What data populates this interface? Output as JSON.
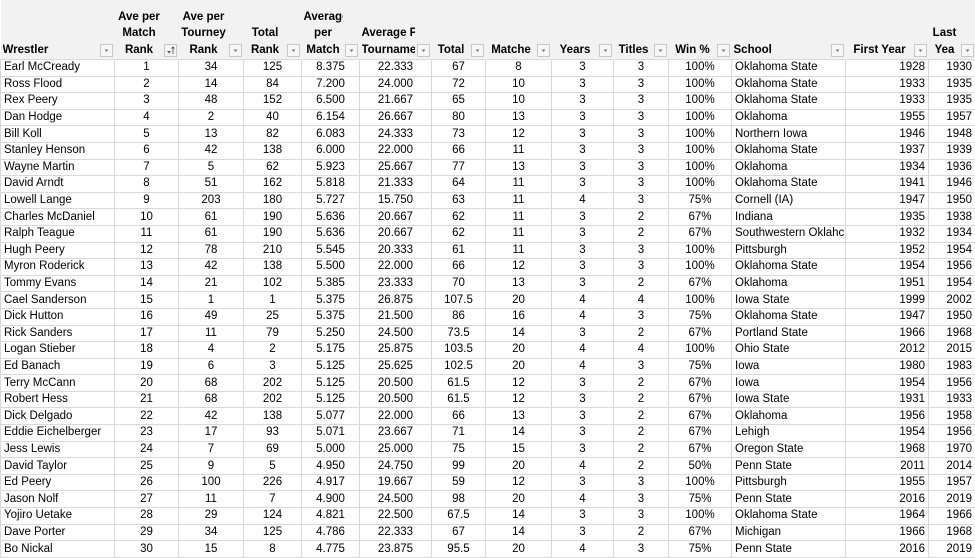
{
  "columns": [
    {
      "key": "wrestler",
      "label_lines": [
        "Wrestler"
      ],
      "align": "left",
      "filter": "dropdown"
    },
    {
      "key": "match_rank",
      "label_lines": [
        "Ave per",
        "Match",
        "Rank"
      ],
      "align": "center",
      "filter": "sorted-ascending"
    },
    {
      "key": "tourney_rank",
      "label_lines": [
        "Ave per",
        "Tourney",
        "Rank"
      ],
      "align": "center",
      "filter": "dropdown"
    },
    {
      "key": "total_rank",
      "label_lines": [
        "Total",
        "Rank"
      ],
      "align": "center",
      "filter": "dropdown"
    },
    {
      "key": "avg_match",
      "label_lines": [
        "Average",
        "per",
        "Match"
      ],
      "align": "center",
      "filter": "dropdown"
    },
    {
      "key": "avg_tourney",
      "label_lines": [
        "Average Per",
        "Tourname"
      ],
      "align": "center",
      "filter": "dropdown"
    },
    {
      "key": "total",
      "label_lines": [
        "Total"
      ],
      "align": "center",
      "filter": "dropdown"
    },
    {
      "key": "matches",
      "label_lines": [
        "Matche"
      ],
      "align": "center",
      "filter": "dropdown"
    },
    {
      "key": "years",
      "label_lines": [
        "Years"
      ],
      "align": "center",
      "filter": "dropdown"
    },
    {
      "key": "titles",
      "label_lines": [
        "Titles"
      ],
      "align": "center",
      "filter": "dropdown"
    },
    {
      "key": "win_pct",
      "label_lines": [
        "Win %"
      ],
      "align": "center",
      "filter": "dropdown"
    },
    {
      "key": "school",
      "label_lines": [
        "School"
      ],
      "align": "left",
      "filter": "dropdown"
    },
    {
      "key": "first_year",
      "label_lines": [
        "First Year"
      ],
      "align": "center",
      "filter": "dropdown"
    },
    {
      "key": "last_year",
      "label_lines": [
        "Last",
        "Yea"
      ],
      "align": "center",
      "filter": "dropdown"
    }
  ],
  "rows": [
    [
      "Earl McCready",
      "1",
      "34",
      "125",
      "8.375",
      "22.333",
      "67",
      "8",
      "3",
      "3",
      "100%",
      "Oklahoma State",
      "1928",
      "1930"
    ],
    [
      "Ross Flood",
      "2",
      "14",
      "84",
      "7.200",
      "24.000",
      "72",
      "10",
      "3",
      "3",
      "100%",
      "Oklahoma State",
      "1933",
      "1935"
    ],
    [
      "Rex Peery",
      "3",
      "48",
      "152",
      "6.500",
      "21.667",
      "65",
      "10",
      "3",
      "3",
      "100%",
      "Oklahoma State",
      "1933",
      "1935"
    ],
    [
      "Dan Hodge",
      "4",
      "2",
      "40",
      "6.154",
      "26.667",
      "80",
      "13",
      "3",
      "3",
      "100%",
      "Oklahoma",
      "1955",
      "1957"
    ],
    [
      "Bill Koll",
      "5",
      "13",
      "82",
      "6.083",
      "24.333",
      "73",
      "12",
      "3",
      "3",
      "100%",
      "Northern Iowa",
      "1946",
      "1948"
    ],
    [
      "Stanley Henson",
      "6",
      "42",
      "138",
      "6.000",
      "22.000",
      "66",
      "11",
      "3",
      "3",
      "100%",
      "Oklahoma State",
      "1937",
      "1939"
    ],
    [
      "Wayne Martin",
      "7",
      "5",
      "62",
      "5.923",
      "25.667",
      "77",
      "13",
      "3",
      "3",
      "100%",
      "Oklahoma",
      "1934",
      "1936"
    ],
    [
      "David Arndt",
      "8",
      "51",
      "162",
      "5.818",
      "21.333",
      "64",
      "11",
      "3",
      "3",
      "100%",
      "Oklahoma State",
      "1941",
      "1946"
    ],
    [
      "Lowell Lange",
      "9",
      "203",
      "180",
      "5.727",
      "15.750",
      "63",
      "11",
      "4",
      "3",
      "75%",
      "Cornell (IA)",
      "1947",
      "1950"
    ],
    [
      "Charles McDaniel",
      "10",
      "61",
      "190",
      "5.636",
      "20.667",
      "62",
      "11",
      "3",
      "2",
      "67%",
      "Indiana",
      "1935",
      "1938"
    ],
    [
      "Ralph Teague",
      "11",
      "61",
      "190",
      "5.636",
      "20.667",
      "62",
      "11",
      "3",
      "2",
      "67%",
      "Southwestern Oklahc",
      "1932",
      "1934"
    ],
    [
      "Hugh Peery",
      "12",
      "78",
      "210",
      "5.545",
      "20.333",
      "61",
      "11",
      "3",
      "3",
      "100%",
      "Pittsburgh",
      "1952",
      "1954"
    ],
    [
      "Myron Roderick",
      "13",
      "42",
      "138",
      "5.500",
      "22.000",
      "66",
      "12",
      "3",
      "3",
      "100%",
      "Oklahoma State",
      "1954",
      "1956"
    ],
    [
      "Tommy Evans",
      "14",
      "21",
      "102",
      "5.385",
      "23.333",
      "70",
      "13",
      "3",
      "2",
      "67%",
      "Oklahoma",
      "1951",
      "1954"
    ],
    [
      "Cael Sanderson",
      "15",
      "1",
      "1",
      "5.375",
      "26.875",
      "107.5",
      "20",
      "4",
      "4",
      "100%",
      "Iowa State",
      "1999",
      "2002"
    ],
    [
      "Dick Hutton",
      "16",
      "49",
      "25",
      "5.375",
      "21.500",
      "86",
      "16",
      "4",
      "3",
      "75%",
      "Oklahoma State",
      "1947",
      "1950"
    ],
    [
      "Rick Sanders",
      "17",
      "11",
      "79",
      "5.250",
      "24.500",
      "73.5",
      "14",
      "3",
      "2",
      "67%",
      "Portland State",
      "1966",
      "1968"
    ],
    [
      "Logan Stieber",
      "18",
      "4",
      "2",
      "5.175",
      "25.875",
      "103.5",
      "20",
      "4",
      "4",
      "100%",
      "Ohio State",
      "2012",
      "2015"
    ],
    [
      "Ed Banach",
      "19",
      "6",
      "3",
      "5.125",
      "25.625",
      "102.5",
      "20",
      "4",
      "3",
      "75%",
      "Iowa",
      "1980",
      "1983"
    ],
    [
      "Terry McCann",
      "20",
      "68",
      "202",
      "5.125",
      "20.500",
      "61.5",
      "12",
      "3",
      "2",
      "67%",
      "Iowa",
      "1954",
      "1956"
    ],
    [
      "Robert Hess",
      "21",
      "68",
      "202",
      "5.125",
      "20.500",
      "61.5",
      "12",
      "3",
      "2",
      "67%",
      "Iowa State",
      "1931",
      "1933"
    ],
    [
      "Dick Delgado",
      "22",
      "42",
      "138",
      "5.077",
      "22.000",
      "66",
      "13",
      "3",
      "2",
      "67%",
      "Oklahoma",
      "1956",
      "1958"
    ],
    [
      "Eddie Eichelberger",
      "23",
      "17",
      "93",
      "5.071",
      "23.667",
      "71",
      "14",
      "3",
      "2",
      "67%",
      "Lehigh",
      "1954",
      "1956"
    ],
    [
      "Jess Lewis",
      "24",
      "7",
      "69",
      "5.000",
      "25.000",
      "75",
      "15",
      "3",
      "2",
      "67%",
      "Oregon State",
      "1968",
      "1970"
    ],
    [
      "David Taylor",
      "25",
      "9",
      "5",
      "4.950",
      "24.750",
      "99",
      "20",
      "4",
      "2",
      "50%",
      "Penn State",
      "2011",
      "2014"
    ],
    [
      "Ed Peery",
      "26",
      "100",
      "226",
      "4.917",
      "19.667",
      "59",
      "12",
      "3",
      "3",
      "100%",
      "Pittsburgh",
      "1955",
      "1957"
    ],
    [
      "Jason Nolf",
      "27",
      "11",
      "7",
      "4.900",
      "24.500",
      "98",
      "20",
      "4",
      "3",
      "75%",
      "Penn State",
      "2016",
      "2019"
    ],
    [
      "Yojiro Uetake",
      "28",
      "29",
      "124",
      "4.821",
      "22.500",
      "67.5",
      "14",
      "3",
      "3",
      "100%",
      "Oklahoma State",
      "1964",
      "1966"
    ],
    [
      "Dave Porter",
      "29",
      "34",
      "125",
      "4.786",
      "22.333",
      "67",
      "14",
      "3",
      "2",
      "67%",
      "Michigan",
      "1966",
      "1968"
    ],
    [
      "Bo Nickal",
      "30",
      "15",
      "8",
      "4.775",
      "23.875",
      "95.5",
      "20",
      "4",
      "3",
      "75%",
      "Penn State",
      "2016",
      "2019"
    ]
  ],
  "icons": {
    "filter_dropdown": "chevron-down-icon",
    "filter_sorted": "sort-ascending-icon"
  }
}
